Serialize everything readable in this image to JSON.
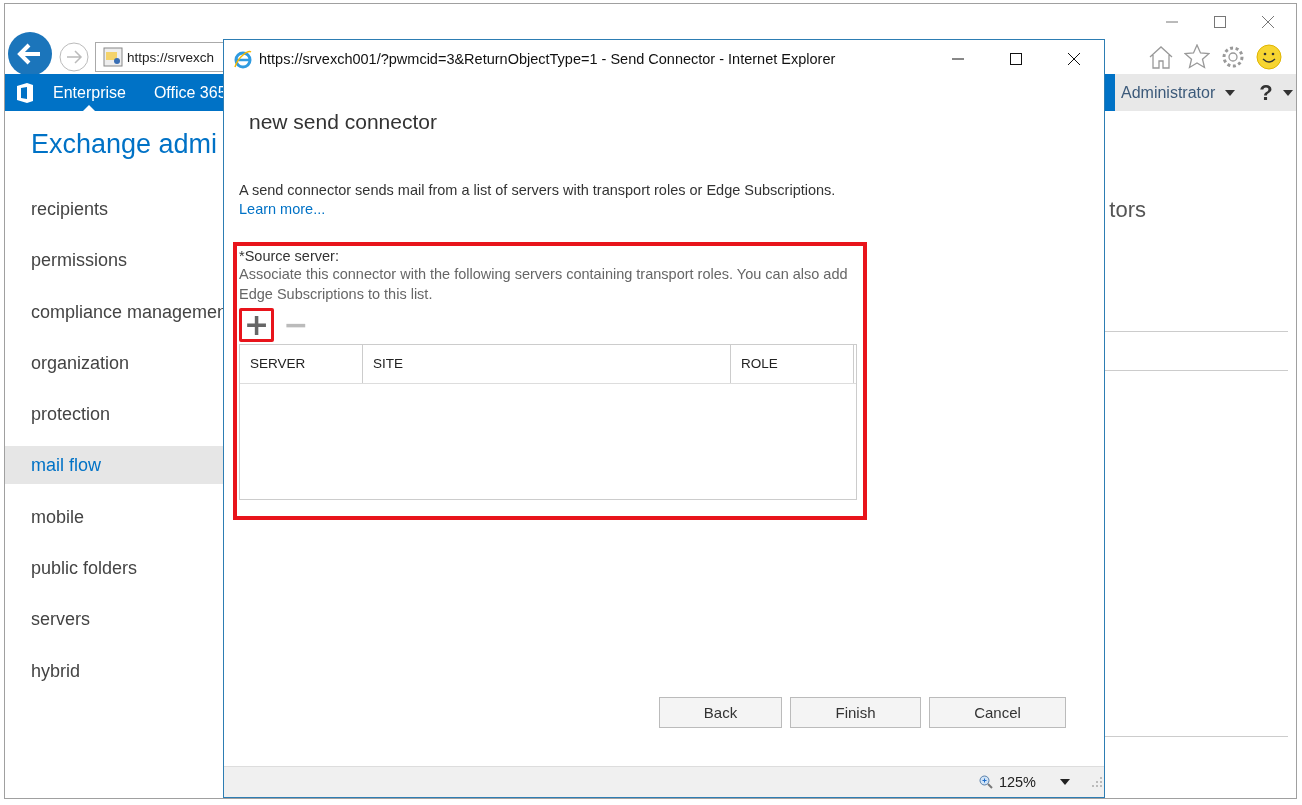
{
  "browser": {
    "address": "https://srvexch",
    "topbar_tabs": [
      {
        "label": "Enterprise",
        "selected": true
      },
      {
        "label": "Office 365",
        "selected": false
      }
    ],
    "user_menu": "Administrator",
    "help_menu": "?"
  },
  "admin": {
    "title": "Exchange admi",
    "nav": [
      {
        "label": "recipients",
        "selected": false
      },
      {
        "label": "permissions",
        "selected": false
      },
      {
        "label": "compliance managemen",
        "selected": false
      },
      {
        "label": "organization",
        "selected": false
      },
      {
        "label": "protection",
        "selected": false
      },
      {
        "label": "mail flow",
        "selected": true
      },
      {
        "label": "mobile",
        "selected": false
      },
      {
        "label": "public folders",
        "selected": false
      },
      {
        "label": "servers",
        "selected": false
      },
      {
        "label": "hybrid",
        "selected": false
      }
    ],
    "content_heading": "tors"
  },
  "popup": {
    "window_title": "https://srvexch001/?pwmcid=3&ReturnObjectType=1 - Send Connector - Internet Explorer",
    "heading": "new send connector",
    "description": "A send connector sends mail from a list of servers with transport roles or Edge Subscriptions.",
    "link": "Learn more...",
    "source_server": {
      "label": "*Source server:",
      "help": "Associate this connector with the following servers containing transport roles. You can also add Edge Subscriptions to this list.",
      "add": {
        "symbol": "+",
        "disabled": false
      },
      "remove": {
        "symbol": "−",
        "disabled": true
      },
      "columns": [
        "SERVER",
        "SITE",
        "ROLE"
      ]
    },
    "buttons": [
      "Back",
      "Finish",
      "Cancel"
    ],
    "zoom": "125%"
  }
}
